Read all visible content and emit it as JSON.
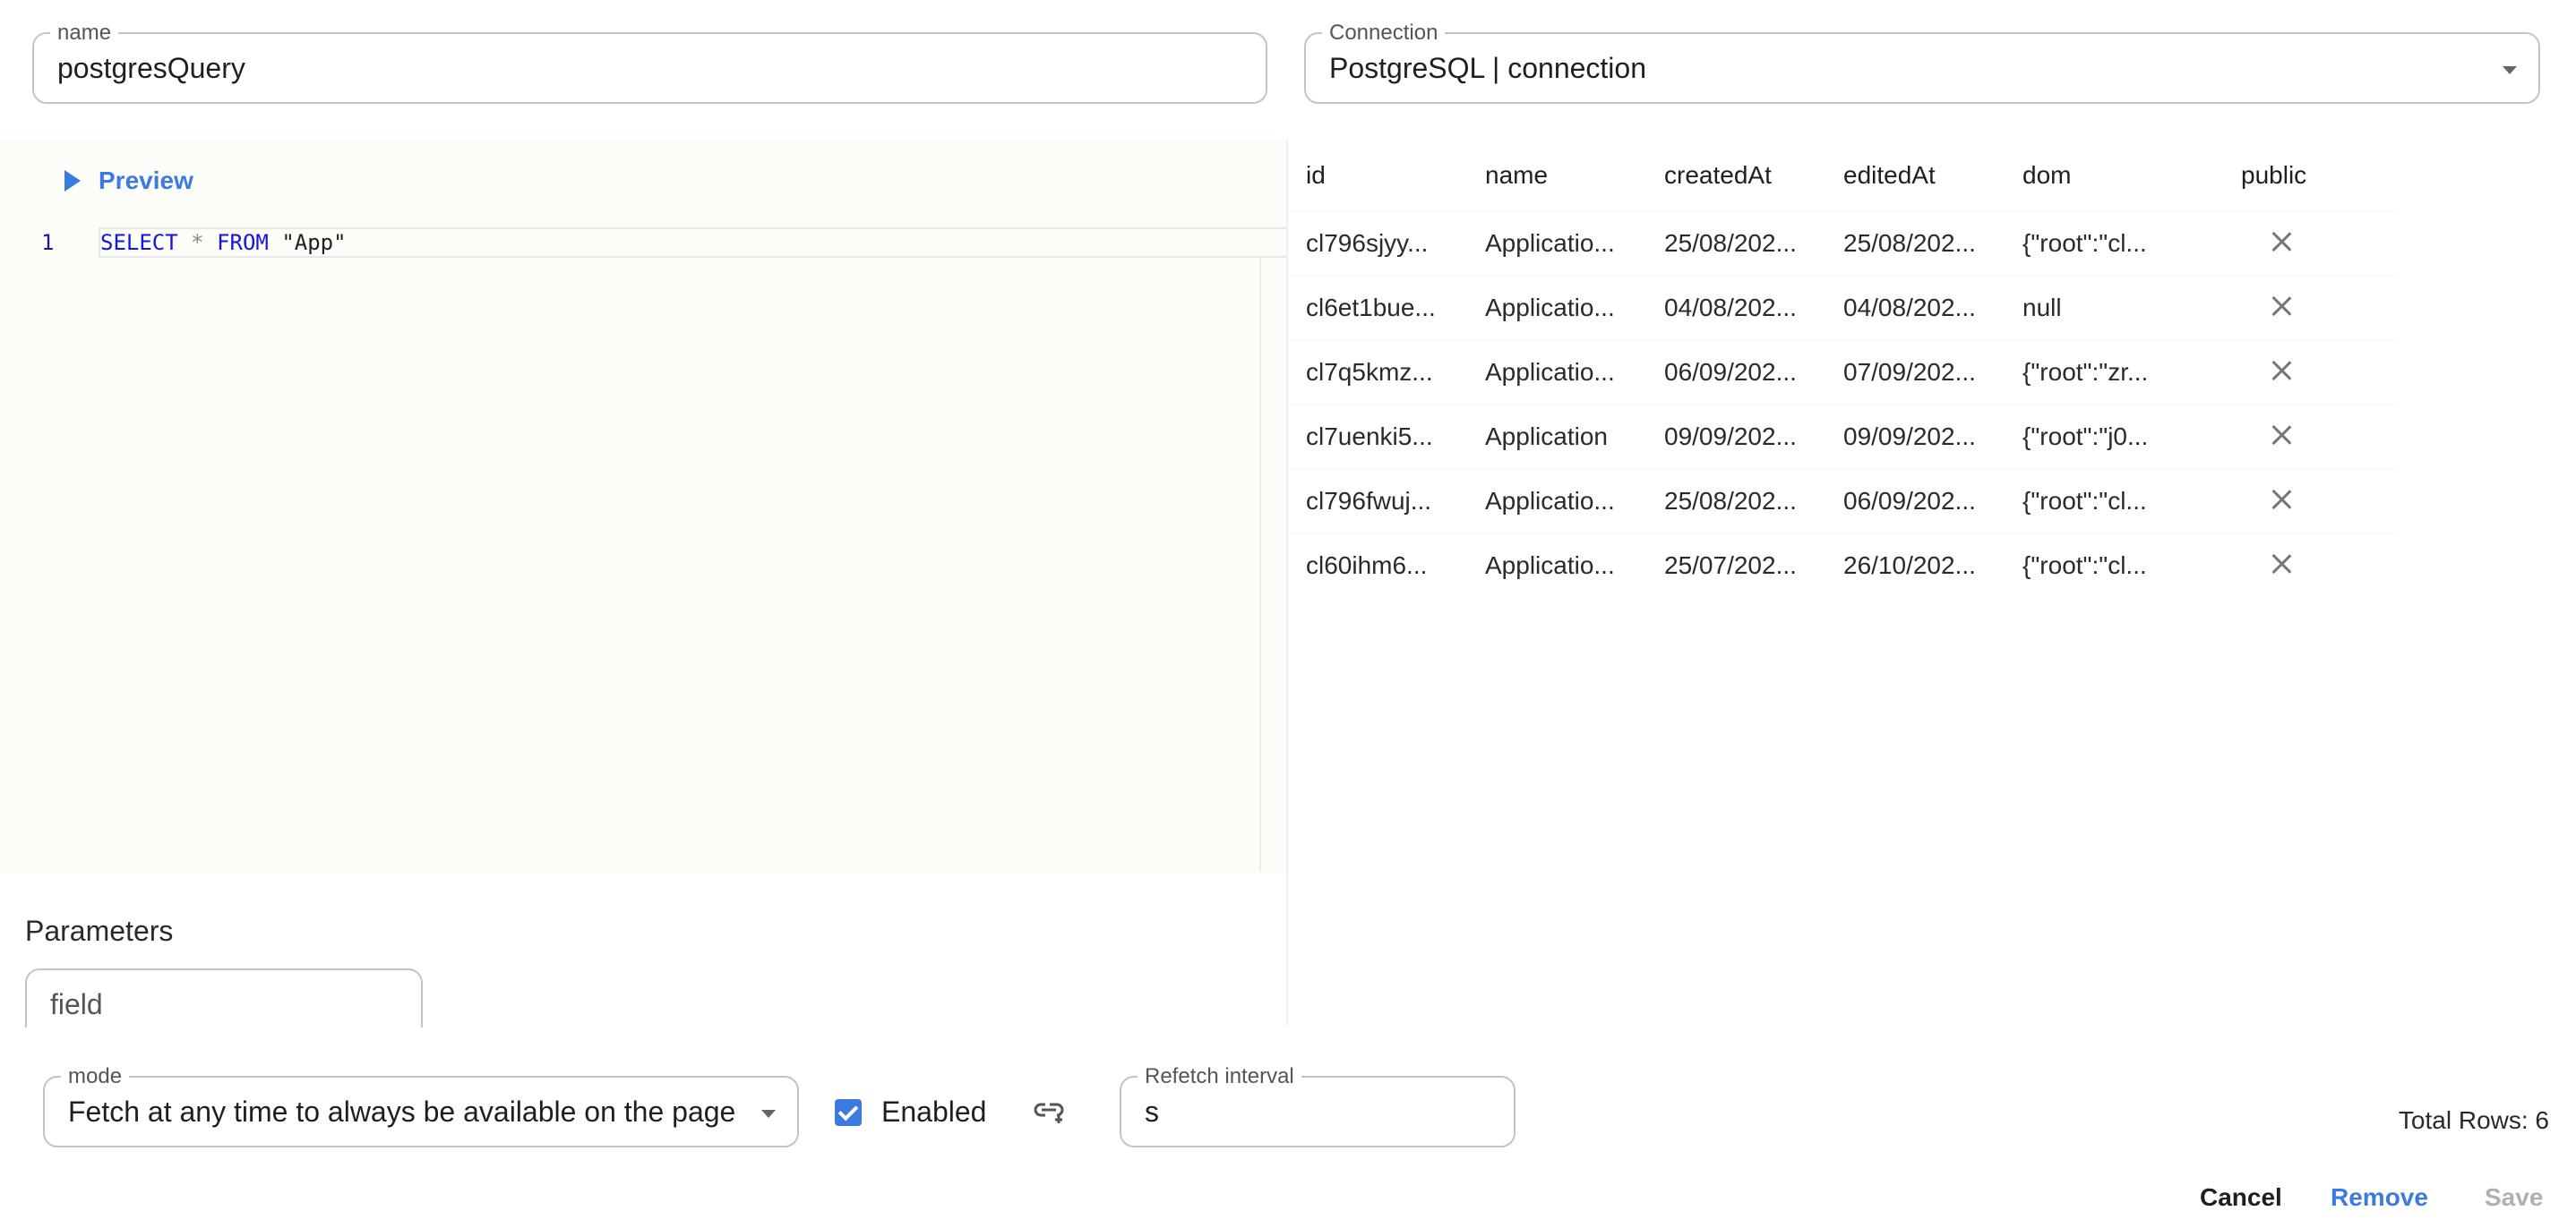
{
  "name_field": {
    "label": "name",
    "value": "postgresQuery"
  },
  "connection_field": {
    "label": "Connection",
    "value": "PostgreSQL | connection"
  },
  "editor": {
    "preview_label": "Preview",
    "line_number": "1",
    "code": {
      "kw1": "SELECT",
      "op": "*",
      "kw2": "FROM",
      "str": "\"App\""
    }
  },
  "parameters": {
    "title": "Parameters",
    "field_placeholder": "field"
  },
  "results": {
    "columns": [
      "id",
      "name",
      "createdAt",
      "editedAt",
      "dom",
      "public"
    ],
    "rows": [
      [
        "cl796sjyy...",
        "Applicatio...",
        "25/08/202...",
        "25/08/202...",
        "{\"root\":\"cl..."
      ],
      [
        "cl6et1bue...",
        "Applicatio...",
        "04/08/202...",
        "04/08/202...",
        "null"
      ],
      [
        "cl7q5kmz...",
        "Applicatio...",
        "06/09/202...",
        "07/09/202...",
        "{\"root\":\"zr..."
      ],
      [
        "cl7uenki5...",
        "Application",
        "09/09/202...",
        "09/09/202...",
        "{\"root\":\"j0..."
      ],
      [
        "cl796fwuj...",
        "Applicatio...",
        "25/08/202...",
        "06/09/202...",
        "{\"root\":\"cl..."
      ],
      [
        "cl60ihm6...",
        "Applicatio...",
        "25/07/202...",
        "26/10/202...",
        "{\"root\":\"cl..."
      ]
    ],
    "public_icon": "close-icon",
    "total_rows": "Total Rows: 6"
  },
  "mode_field": {
    "label": "mode",
    "value": "Fetch at any time to always be available on the page"
  },
  "enabled": {
    "label": "Enabled",
    "checked": true
  },
  "refetch_field": {
    "label": "Refetch interval",
    "value": "s"
  },
  "actions": {
    "cancel": "Cancel",
    "remove": "Remove",
    "save": "Save"
  },
  "colors": {
    "accent": "#3b7be0",
    "disabled": "#b0b0b0"
  }
}
